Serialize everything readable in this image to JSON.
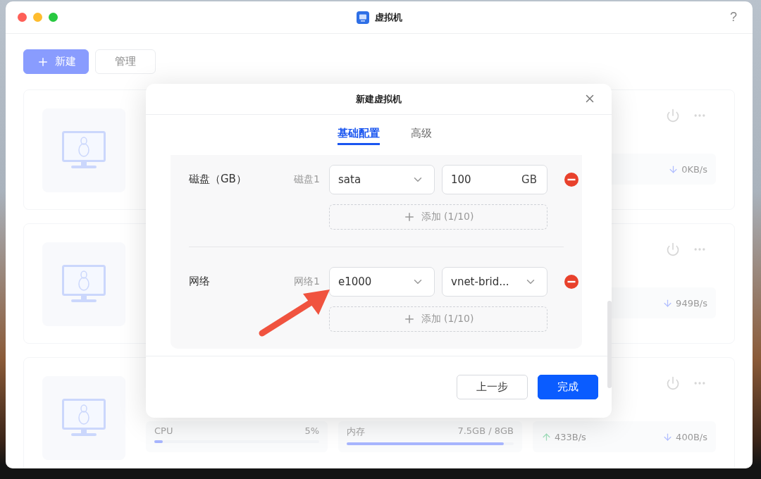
{
  "window": {
    "title": "虚拟机",
    "help": "?"
  },
  "toolbar": {
    "buttons": [
      {
        "label": "新建",
        "kind": "primary"
      },
      {
        "label": "管理",
        "kind": "default"
      }
    ]
  },
  "vm_cards": [
    {
      "download": "0KB/s"
    },
    {
      "download": "949B/s"
    },
    {
      "cpu": {
        "label": "CPU",
        "value": "5%",
        "level": 0.05
      },
      "memory": {
        "label": "内存",
        "value": "7.5GB / 8GB",
        "level": 0.94
      },
      "upload": "433B/s",
      "download": "400B/s"
    }
  ],
  "modal": {
    "title": "新建虚拟机",
    "tabs": [
      {
        "label": "基础配置",
        "selected": true
      },
      {
        "label": "高级",
        "selected": false
      }
    ],
    "sections": [
      {
        "label": "磁盘（GB）",
        "items": [
          {
            "label": "磁盘1",
            "fields": [
              {
                "kind": "select",
                "value": "sata"
              },
              {
                "kind": "input",
                "value": "100",
                "suffix": "GB"
              }
            ]
          }
        ],
        "add_label": "添加 (1/10)"
      },
      {
        "label": "网络",
        "items": [
          {
            "label": "网络1",
            "fields": [
              {
                "kind": "select",
                "value": "e1000"
              },
              {
                "kind": "select",
                "value": "vnet-brid..."
              }
            ]
          }
        ],
        "add_label": "添加 (1/10)"
      }
    ],
    "buttons": [
      {
        "label": "上一步",
        "kind": "default"
      },
      {
        "label": "完成",
        "kind": "primary"
      }
    ]
  }
}
